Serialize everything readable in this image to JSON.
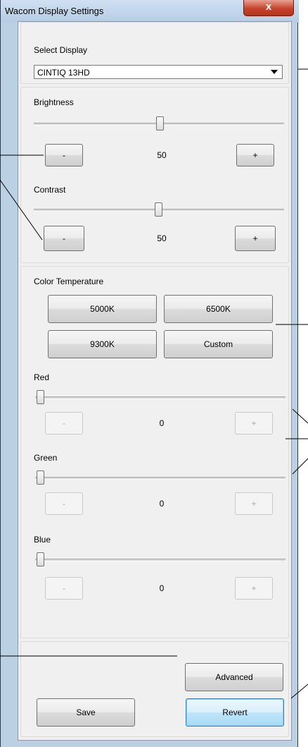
{
  "window": {
    "title": "Wacom Display Settings",
    "close_label": "x"
  },
  "display": {
    "label": "Select Display",
    "selected": "CINTIQ 13HD"
  },
  "brightness": {
    "label": "Brightness",
    "value": "50",
    "minus": "-",
    "plus": "+",
    "slider_fraction": 0.5
  },
  "contrast": {
    "label": "Contrast",
    "value": "50",
    "minus": "-",
    "plus": "+",
    "slider_fraction": 0.5
  },
  "color_temp": {
    "label": "Color Temperature",
    "presets": [
      "5000K",
      "6500K",
      "9300K",
      "Custom"
    ]
  },
  "red": {
    "label": "Red",
    "value": "0",
    "minus": "-",
    "plus": "+",
    "slider_fraction": 0
  },
  "green": {
    "label": "Green",
    "value": "0",
    "minus": "-",
    "plus": "+",
    "slider_fraction": 0
  },
  "blue": {
    "label": "Blue",
    "value": "0",
    "minus": "-",
    "plus": "+",
    "slider_fraction": 0
  },
  "buttons": {
    "advanced": "Advanced",
    "save": "Save",
    "revert": "Revert"
  }
}
